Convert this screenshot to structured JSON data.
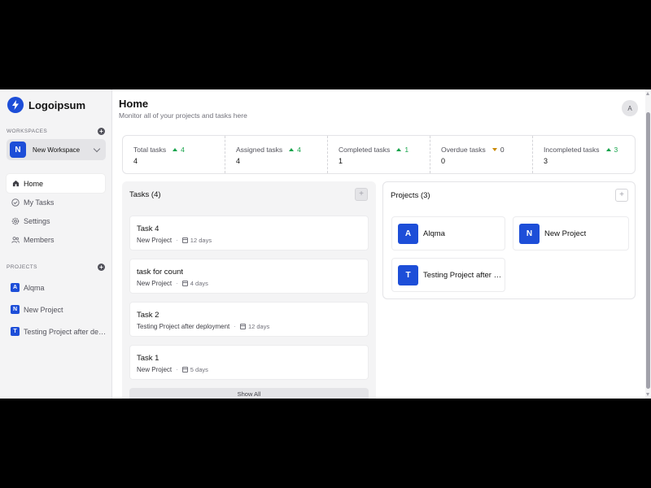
{
  "brand": {
    "name": "Logoipsum"
  },
  "sidebar": {
    "workspaces_label": "WORKSPACES",
    "workspace": {
      "initial": "N",
      "name": "New Workspace"
    },
    "nav": [
      {
        "label": "Home",
        "icon": "home-icon"
      },
      {
        "label": "My Tasks",
        "icon": "check-circle-icon"
      },
      {
        "label": "Settings",
        "icon": "gear-icon"
      },
      {
        "label": "Members",
        "icon": "users-icon"
      }
    ],
    "projects_label": "PROJECTS",
    "projects": [
      {
        "initial": "A",
        "name": "Alqma"
      },
      {
        "initial": "N",
        "name": "New Project"
      },
      {
        "initial": "T",
        "name": "Testing Project after deployment"
      }
    ]
  },
  "header": {
    "title": "Home",
    "subtitle": "Monitor all of your projects and tasks here",
    "user_initial": "A"
  },
  "stats": [
    {
      "label": "Total tasks",
      "trend": "up",
      "delta": "4",
      "value": "4"
    },
    {
      "label": "Assigned tasks",
      "trend": "up",
      "delta": "4",
      "value": "4"
    },
    {
      "label": "Completed tasks",
      "trend": "up",
      "delta": "1",
      "value": "1"
    },
    {
      "label": "Overdue tasks",
      "trend": "down",
      "delta": "0",
      "value": "0"
    },
    {
      "label": "Incompleted tasks",
      "trend": "up",
      "delta": "3",
      "value": "3"
    }
  ],
  "tasks_panel": {
    "title": "Tasks (4)",
    "add_label": "+",
    "tasks": [
      {
        "name": "Task 4",
        "project": "New Project",
        "due": "12 days"
      },
      {
        "name": "task for count",
        "project": "New Project",
        "due": "4 days"
      },
      {
        "name": "Task 2",
        "project": "Testing Project after deployment",
        "due": "12 days"
      },
      {
        "name": "Task 1",
        "project": "New Project",
        "due": "5 days"
      }
    ],
    "show_all_label": "Show All"
  },
  "projects_panel": {
    "title": "Projects (3)",
    "add_label": "+",
    "projects": [
      {
        "initial": "A",
        "name": "Alqma"
      },
      {
        "initial": "N",
        "name": "New Project"
      },
      {
        "initial": "T",
        "name": "Testing Project after deployment"
      }
    ]
  },
  "colors": {
    "brand": "#1d4ed8",
    "trend_up": "#16a34a",
    "trend_down": "#ca8a04"
  }
}
